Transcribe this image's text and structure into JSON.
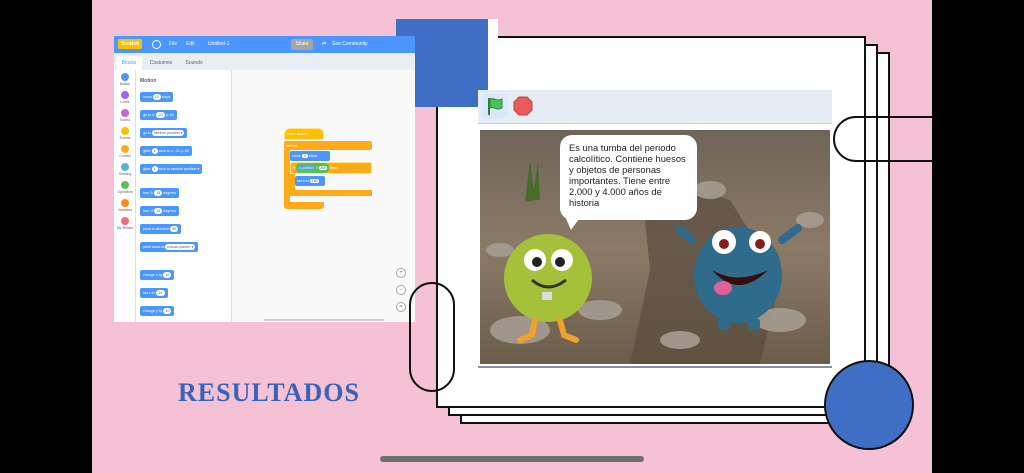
{
  "slide": {
    "title": "RESULTADOS",
    "colors": {
      "background": "#f4c2d4",
      "accent_blue": "#3f6fc4",
      "scratch_blue": "#4c97ff"
    }
  },
  "editor": {
    "logo": "Scratch",
    "menu": [
      "File",
      "Edit"
    ],
    "project_title": "Untitled-1",
    "share_label": "Share",
    "see_community_label": "See Community",
    "tabs": [
      {
        "label": "Blocks",
        "active": true
      },
      {
        "label": "Costumes",
        "active": false
      },
      {
        "label": "Sounds",
        "active": false
      }
    ],
    "categories": [
      {
        "label": "Motion",
        "color": "#4c97ff"
      },
      {
        "label": "Looks",
        "color": "#9966ff"
      },
      {
        "label": "Sound",
        "color": "#cf63cf"
      },
      {
        "label": "Events",
        "color": "#ffbf00"
      },
      {
        "label": "Control",
        "color": "#ffab19"
      },
      {
        "label": "Sensing",
        "color": "#5cb1d6"
      },
      {
        "label": "Operators",
        "color": "#59c059"
      },
      {
        "label": "Variables",
        "color": "#ff8c1a"
      },
      {
        "label": "My Blocks",
        "color": "#ff6680"
      }
    ],
    "palette_title": "Motion",
    "palette_blocks": [
      {
        "pre": "move",
        "val": "10",
        "post": "steps"
      },
      {
        "pre": "go to x:",
        "val": "-21",
        "post": "y: 69"
      },
      {
        "pre": "go to",
        "val": "random position ▾",
        "post": ""
      },
      {
        "pre": "glide",
        "val": "1",
        "post": "secs to x: -21 y: 69"
      },
      {
        "pre": "glide",
        "val": "1",
        "post": "secs to random position ▾"
      },
      {
        "pre": "turn ↻",
        "val": "15",
        "post": "degrees"
      },
      {
        "pre": "turn ↺",
        "val": "15",
        "post": "degrees"
      },
      {
        "pre": "point in direction",
        "val": "90",
        "post": ""
      },
      {
        "pre": "point towards",
        "val": "mouse-pointer ▾",
        "post": ""
      },
      {
        "pre": "change x by",
        "val": "10",
        "post": ""
      },
      {
        "pre": "set x to",
        "val": "-21",
        "post": ""
      },
      {
        "pre": "change y by",
        "val": "10",
        "post": ""
      }
    ],
    "script": {
      "hat": "when  clicked",
      "loop": "forever",
      "move_pre": "move",
      "move_val": "4",
      "move_post": "steps",
      "if_label": "if",
      "cond_pre": "x position",
      "cond_op": ">",
      "cond_val": "260",
      "then_label": "then",
      "set_pre": "set x to",
      "set_val": "-180"
    }
  },
  "stage": {
    "speech": "Es una tumba del periodo calcolítico. Contiene huesos y objetos de personas importantes. Tiene entre 2.000 y 4.000 años de historia",
    "icons": [
      "green-flag-icon",
      "stop-icon"
    ]
  }
}
